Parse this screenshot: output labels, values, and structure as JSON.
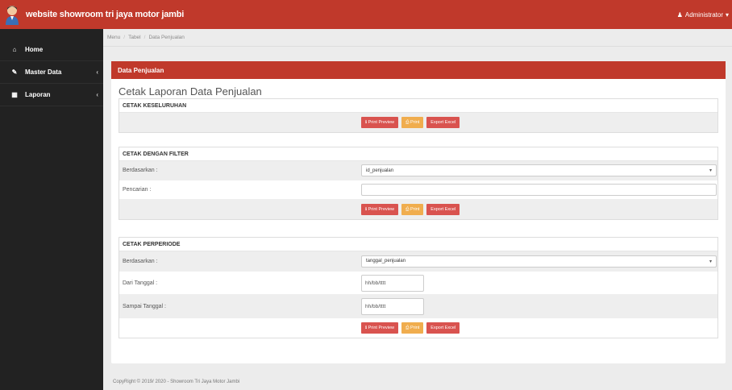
{
  "navbar": {
    "title": "website showroom tri jaya motor jambi",
    "user_label": "Administrator",
    "user_icon": "user-icon"
  },
  "sidebar": {
    "items": [
      {
        "label": "Home",
        "icon": "home-icon"
      },
      {
        "label": "Master Data",
        "icon": "edit-icon"
      },
      {
        "label": "Laporan",
        "icon": "calendar-icon"
      }
    ]
  },
  "breadcrumb": {
    "items": [
      "Menu",
      "Tabel",
      "Data Penjualan"
    ]
  },
  "panel": {
    "header": "Data Penjualan",
    "title": "Cetak Laporan Data Penjualan"
  },
  "buttons": {
    "preview": "Print Preview",
    "print": "Print",
    "excel": "Export Excel"
  },
  "section_all": {
    "title": "CETAK KESELURUHAN"
  },
  "section_filter": {
    "title": "CETAK DENGAN FILTER",
    "by_label": "Berdasarkan :",
    "by_value": "id_penjualan",
    "search_label": "Pencarian :",
    "search_value": ""
  },
  "section_period": {
    "title": "CETAK PERPERIODE",
    "by_label": "Berdasarkan :",
    "by_value": "tanggal_penjualan",
    "from_label": "Dari Tanggal :",
    "from_placeholder": "hh/bb/tttt",
    "to_label": "Sampai Tanggal :",
    "to_placeholder": "hh/bb/tttt"
  },
  "footer": {
    "text": "CopyRight © 2019/ 2020 - Showroom Tri Jaya Motor Jambi"
  },
  "colors": {
    "brand": "#c0392b",
    "sidebar": "#222222",
    "btn_red": "#d9534f",
    "btn_orange": "#f0ad4e"
  }
}
